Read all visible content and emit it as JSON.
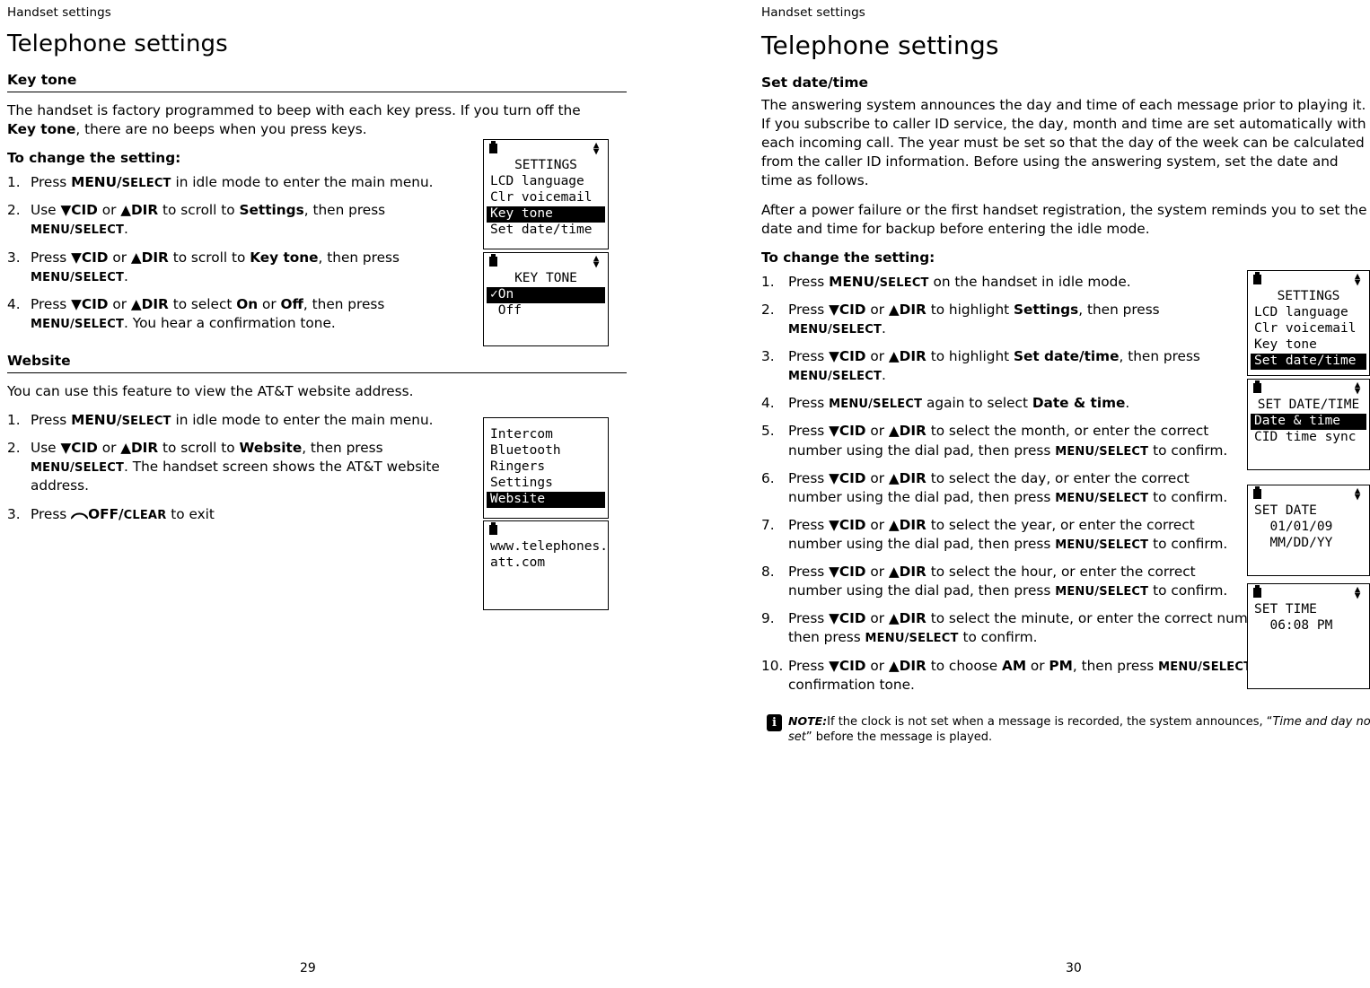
{
  "left_page": {
    "running_head": "Handset settings",
    "chapter_title": "Telephone settings",
    "folio": "29",
    "key_tone": {
      "heading": "Key tone",
      "intro_1": "The handset is factory programmed to beep with each key press. If you turn off the ",
      "intro_bold": "Key tone",
      "intro_2": ", there are no beeps when you press keys.",
      "lead_in": "To change the setting:",
      "steps": [
        {
          "num": "1.",
          "parts": [
            "Press ",
            "MENU/",
            "SELECT",
            " in idle mode to enter the main menu."
          ]
        },
        {
          "num": "2.",
          "parts": [
            "Use ",
            "▼CID",
            " or ",
            "▲DIR",
            " to scroll to ",
            "Settings",
            ", then press ",
            "MENU/SELECT",
            "."
          ]
        },
        {
          "num": "3.",
          "parts": [
            "Press ",
            "▼CID",
            " or ",
            "▲DIR",
            " to scroll to ",
            "Key tone",
            ", then press ",
            "MENU/SELECT",
            "."
          ]
        },
        {
          "num": "4.",
          "parts": [
            "Press ",
            "▼CID",
            " or ",
            "▲DIR",
            " to select ",
            "On",
            " or ",
            "Off",
            ", then press ",
            "MENU/SELECT",
            ". You hear a confirmation tone."
          ]
        }
      ]
    },
    "website": {
      "heading": "Website",
      "intro": "You can use this feature to view the AT&T website address.",
      "steps": [
        {
          "num": "1.",
          "parts": [
            "Press ",
            "MENU/",
            "SELECT",
            " in idle mode to enter the main menu."
          ]
        },
        {
          "num": "2.",
          "parts": [
            "Use ",
            "▼CID",
            " or ",
            "▲DIR",
            " to scroll to ",
            "Website",
            ", then press ",
            "MENU/SELECT",
            ". The handset screen shows the AT&T website address."
          ]
        },
        {
          "num": "3.",
          "parts": [
            "Press ",
            "OFF/",
            "CLEAR",
            " to exit"
          ]
        }
      ]
    },
    "screens": [
      {
        "name": "settings-menu",
        "lines": [
          {
            "text": "SETTINGS",
            "style": "center"
          },
          {
            "text": "LCD language",
            "style": "plain"
          },
          {
            "text": "Clr voicemail",
            "style": "plain"
          },
          {
            "text": "Key tone",
            "style": "highlight"
          },
          {
            "text": "Set date/time",
            "style": "plain"
          }
        ]
      },
      {
        "name": "key-tone-menu",
        "lines": [
          {
            "text": "KEY TONE",
            "style": "center"
          },
          {
            "text": "✓On",
            "style": "highlight"
          },
          {
            "text": " Off",
            "style": "plain"
          }
        ]
      },
      {
        "name": "main-menu",
        "lines": [
          {
            "text": "Intercom",
            "style": "plain"
          },
          {
            "text": "Bluetooth",
            "style": "plain"
          },
          {
            "text": "Ringers",
            "style": "plain"
          },
          {
            "text": "Settings",
            "style": "plain"
          },
          {
            "text": "Website",
            "style": "highlight"
          }
        ]
      },
      {
        "name": "website-address",
        "lines": [
          {
            "text": "www.telephones.",
            "style": "plain"
          },
          {
            "text": "att.com",
            "style": "plain"
          }
        ]
      }
    ]
  },
  "right_page": {
    "running_head": "Handset settings",
    "chapter_title": "Telephone settings",
    "folio": "30",
    "set_date_time": {
      "heading": "Set date/time",
      "para_1": "The answering system announces the day and time of each message prior to playing it. If you subscribe to caller ID service, the day, month and time are set automatically with each incoming call. The year must be set so that the day of the week can be calculated from the caller ID information. Before using the answering system, set the date and time as follows.",
      "para_2": "After a power failure or the first handset registration, the system reminds you to set the date and time for backup before entering the idle mode.",
      "lead_in": "To change the setting:",
      "steps": [
        {
          "num": "1.",
          "parts": [
            "Press ",
            "MENU/",
            "SELECT",
            " on the handset in idle mode."
          ]
        },
        {
          "num": "2.",
          "parts": [
            "Press ",
            "▼CID",
            " or ",
            "▲DIR",
            " to highlight ",
            "Settings",
            ", then press ",
            "MENU/SELECT",
            "."
          ]
        },
        {
          "num": "3.",
          "parts": [
            "Press ",
            "▼CID",
            " or ",
            "▲DIR",
            " to highlight ",
            "Set date/time",
            ", then press ",
            "MENU/SELECT",
            "."
          ]
        },
        {
          "num": "4.",
          "parts": [
            "Press ",
            "MENU/SELECT",
            " again to select ",
            "Date & time",
            "."
          ]
        },
        {
          "num": "5.",
          "parts": [
            "Press ",
            "▼CID",
            " or ",
            "▲DIR",
            " to select the month, or enter the correct number using the dial pad, then press ",
            "MENU/SELECT",
            " to confirm."
          ]
        },
        {
          "num": "6.",
          "parts": [
            "Press ",
            "▼CID",
            " or ",
            "▲DIR",
            " to select the day, or enter the correct number using the dial pad, then press ",
            "MENU/SELECT",
            " to confirm."
          ]
        },
        {
          "num": "7.",
          "parts": [
            "Press ",
            "▼CID",
            " or ",
            "▲DIR",
            " to select the year, or enter the correct number using the dial pad, then press ",
            "MENU/SELECT",
            " to confirm."
          ]
        },
        {
          "num": "8.",
          "parts": [
            "Press ",
            "▼CID",
            " or ",
            "▲DIR",
            " to select the hour, or enter the correct number using the dial pad, then press ",
            "MENU/SELECT",
            " to confirm."
          ]
        },
        {
          "num": "9.",
          "parts": [
            "Press ",
            "▼CID",
            " or ",
            "▲DIR",
            " to select the minute, or enter the correct number using the dial pad, then press ",
            "MENU/SELECT",
            " to confirm."
          ]
        },
        {
          "num": "10.",
          "parts": [
            "Press ",
            "▼CID",
            " or ",
            "▲DIR",
            " to choose ",
            "AM",
            " or ",
            "PM",
            ", then press ",
            "MENU/SELECT",
            " to confirm. You hear a confirmation tone."
          ]
        }
      ]
    },
    "note": {
      "label": "NOTE:",
      "text_1": "If the clock is not set when a message is recorded, the system announces, “",
      "italic": "Time and day not set",
      "text_2": "” before the message is played."
    },
    "screens": [
      {
        "name": "settings-menu",
        "lines": [
          {
            "text": "SETTINGS",
            "style": "center"
          },
          {
            "text": "LCD language",
            "style": "plain"
          },
          {
            "text": "Clr voicemail",
            "style": "plain"
          },
          {
            "text": "Key tone",
            "style": "plain"
          },
          {
            "text": "Set date/time",
            "style": "highlight"
          }
        ]
      },
      {
        "name": "set-date-time-menu",
        "lines": [
          {
            "text": "SET DATE/TIME",
            "style": "center"
          },
          {
            "text": "Date & time",
            "style": "highlight"
          },
          {
            "text": "CID time sync",
            "style": "plain"
          }
        ]
      },
      {
        "name": "set-date-screen",
        "lines": [
          {
            "text": "SET DATE",
            "style": "plain"
          },
          {
            "text": "  01/01/09",
            "style": "plain"
          },
          {
            "text": "  MM/DD/YY",
            "style": "plain"
          }
        ]
      },
      {
        "name": "set-time-screen",
        "lines": [
          {
            "text": "SET TIME",
            "style": "plain"
          },
          {
            "text": "  06:08 PM",
            "style": "plain"
          }
        ]
      }
    ]
  }
}
